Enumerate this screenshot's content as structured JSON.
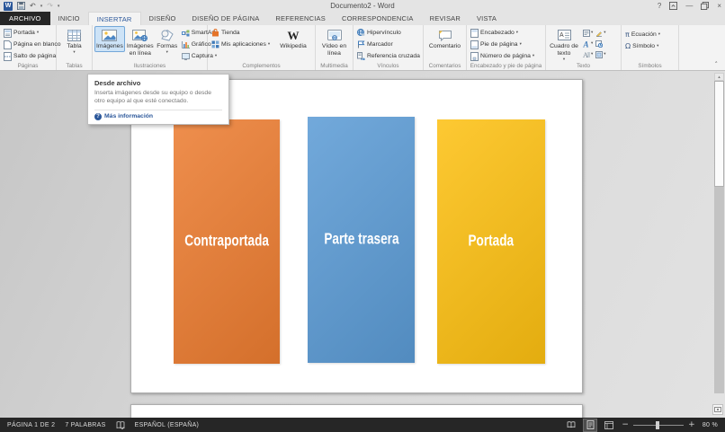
{
  "titlebar": {
    "title": "Documento2 - Word"
  },
  "tabs": [
    "ARCHIVO",
    "INICIO",
    "INSERTAR",
    "DISEÑO",
    "DISEÑO DE PÁGINA",
    "REFERENCIAS",
    "CORRESPONDENCIA",
    "REVISAR",
    "VISTA"
  ],
  "ribbon": {
    "paginas": {
      "label": "Páginas",
      "portada": "Portada",
      "pagina_blanco": "Página en blanco",
      "salto": "Salto de página"
    },
    "tablas": {
      "label": "Tablas",
      "tabla": "Tabla"
    },
    "ilustraciones": {
      "label": "Ilustraciones",
      "imagenes": "Imágenes",
      "imagenes_linea": "Imágenes en línea",
      "formas": "Formas",
      "smartart": "SmartArt",
      "grafico": "Gráfico",
      "captura": "Captura"
    },
    "complementos": {
      "label": "Complementos",
      "tienda": "Tienda",
      "mis_aplicaciones": "Mis aplicaciones",
      "wikipedia": "Wikipedia"
    },
    "multimedia": {
      "label": "Multimedia",
      "video": "Vídeo en línea"
    },
    "vinculos": {
      "label": "Vínculos",
      "hipervinculo": "Hipervínculo",
      "marcador": "Marcador",
      "referencia": "Referencia cruzada"
    },
    "comentarios": {
      "label": "Comentarios",
      "comentario": "Comentario"
    },
    "encabezado_pie": {
      "label": "Encabezado y pie de página",
      "encabezado": "Encabezado",
      "pie": "Pie de página",
      "numero": "Número de página"
    },
    "texto": {
      "label": "Texto",
      "cuadro_texto": "Cuadro de texto"
    },
    "simbolos": {
      "label": "Símbolos",
      "ecuacion": "Ecuación",
      "simbolo": "Símbolo"
    }
  },
  "tooltip": {
    "title": "Desde archivo",
    "body": "Inserta imágenes desde su equipo o desde otro equipo al que esté conectado.",
    "link": "Más información"
  },
  "document": {
    "boxes": [
      {
        "label": "Contraportada",
        "color": "#EC7C30"
      },
      {
        "label": "Parte trasera",
        "color": "#5B9BD5"
      },
      {
        "label": "Portada",
        "color": "#FDC011"
      }
    ]
  },
  "statusbar": {
    "page": "PÁGINA 1 DE 2",
    "words": "7 PALABRAS",
    "language": "ESPAÑOL (ESPAÑA)",
    "zoom_level": "80 %"
  },
  "icons": {
    "word_logo": "W",
    "undo": "↶",
    "redo": "↷",
    "dropdown": "▾",
    "help": "?",
    "minimize": "—",
    "close": "×",
    "collapse": "˄",
    "wikipedia": "W",
    "pi": "π",
    "omega": "Ω",
    "scroll_up": "▴",
    "zoom_minus": "−",
    "zoom_plus": "+",
    "tooltip_help": "?"
  }
}
